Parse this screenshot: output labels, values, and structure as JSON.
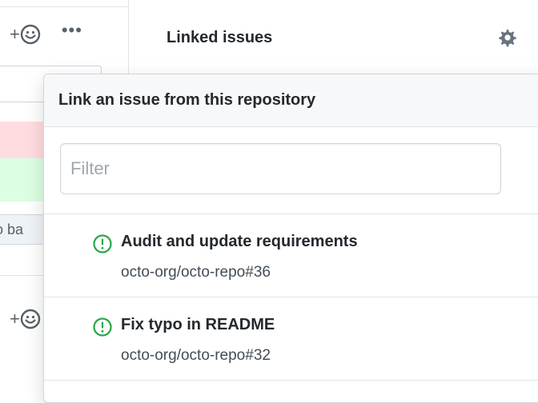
{
  "sidebar": {
    "linked_issues_label": "Linked issues"
  },
  "left": {
    "plus": "+",
    "ellipsis": "•••",
    "snippet_button_text": "o ba"
  },
  "popover": {
    "title": "Link an issue from this repository",
    "filter": {
      "placeholder": "Filter",
      "value": ""
    },
    "issues": [
      {
        "title": "Audit and update requirements",
        "reference": "octo-org/octo-repo#36"
      },
      {
        "title": "Fix typo in README",
        "reference": "octo-org/octo-repo#32"
      }
    ]
  },
  "colors": {
    "open_issue_icon": "#28a745",
    "diff_deletion": "#ffdce0",
    "diff_addition": "#dcffe4",
    "border": "#e1e4e8"
  },
  "icons": [
    "plus-icon",
    "smiley-icon",
    "kebab-horizontal-icon",
    "gear-icon",
    "issue-opened-icon"
  ]
}
